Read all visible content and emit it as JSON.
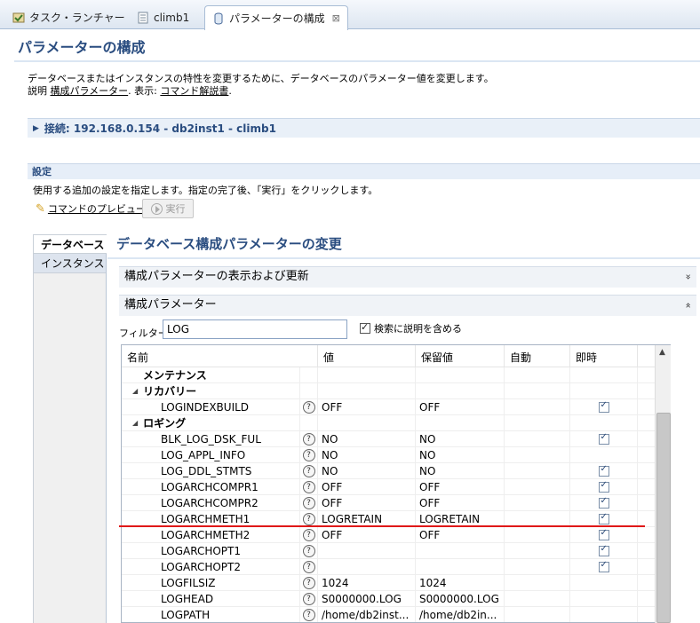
{
  "tabs": [
    {
      "label": "タスク・ランチャー"
    },
    {
      "label": "climb1"
    },
    {
      "label": "パラメーターの構成",
      "close": "⊠"
    }
  ],
  "header": {
    "title": "パラメーターの構成",
    "description": "データベースまたはインスタンスの特性を変更するために、データベースのパラメーター値を変更します。",
    "explain_prefix": "説明",
    "explain_link": "構成パラメーター",
    "view_prefix": ". 表示:",
    "view_link": "コマンド解説書",
    "view_suffix": "."
  },
  "connection": {
    "label": "接続: 192.168.0.154 - db2inst1 - climb1"
  },
  "settings": {
    "title": "設定",
    "description": "使用する追加の設定を指定します。指定の完了後、「実行」をクリックします。",
    "preview_label": "コマンドのプレビュー",
    "execute_label": "実行"
  },
  "side_tabs": [
    {
      "label": "データベース"
    },
    {
      "label": "インスタンス"
    }
  ],
  "main": {
    "section_title": "データベース構成パラメーターの変更",
    "panel1": "構成パラメーターの表示および更新",
    "panel2": "構成パラメーター",
    "filter_label": "フィルター",
    "filter_value": "LOG",
    "include_desc_label": "検索に説明を含める",
    "include_desc_checked": true
  },
  "table": {
    "columns": [
      "名前",
      "値",
      "保留値",
      "自動",
      "即時"
    ],
    "rows": [
      {
        "type": "group0",
        "name": "メンテナンス"
      },
      {
        "type": "group",
        "name": "リカバリー"
      },
      {
        "type": "param",
        "name": "LOGINDEXBUILD",
        "value": "OFF",
        "pending": "OFF",
        "immediate": true
      },
      {
        "type": "group",
        "name": "ロギング"
      },
      {
        "type": "param",
        "name": "BLK_LOG_DSK_FUL",
        "value": "NO",
        "pending": "NO",
        "immediate": true
      },
      {
        "type": "param",
        "name": "LOG_APPL_INFO",
        "value": "NO",
        "pending": "NO",
        "immediate": false
      },
      {
        "type": "param",
        "name": "LOG_DDL_STMTS",
        "value": "NO",
        "pending": "NO",
        "immediate": true
      },
      {
        "type": "param",
        "name": "LOGARCHCOMPR1",
        "value": "OFF",
        "pending": "OFF",
        "immediate": true
      },
      {
        "type": "param",
        "name": "LOGARCHCOMPR2",
        "value": "OFF",
        "pending": "OFF",
        "immediate": true
      },
      {
        "type": "param",
        "name": "LOGARCHMETH1",
        "value": "LOGRETAIN",
        "pending": "LOGRETAIN",
        "immediate": true
      },
      {
        "type": "param",
        "name": "LOGARCHMETH2",
        "value": "OFF",
        "pending": "OFF",
        "immediate": true
      },
      {
        "type": "param",
        "name": "LOGARCHOPT1",
        "value": "",
        "pending": "",
        "immediate": true
      },
      {
        "type": "param",
        "name": "LOGARCHOPT2",
        "value": "",
        "pending": "",
        "immediate": true
      },
      {
        "type": "param",
        "name": "LOGFILSIZ",
        "value": "1024",
        "pending": "1024",
        "immediate": false
      },
      {
        "type": "param",
        "name": "LOGHEAD",
        "value": "S0000000.LOG",
        "pending": "S0000000.LOG",
        "immediate": false
      },
      {
        "type": "param",
        "name": "LOGPATH",
        "value": "/home/db2inst...",
        "pending": "/home/db2in...",
        "immediate": false
      }
    ]
  },
  "icons": {
    "help": "?",
    "expand": "»",
    "collapse": "«"
  },
  "colors": {
    "title": "#2a4d80",
    "annotation": "#e01818"
  }
}
